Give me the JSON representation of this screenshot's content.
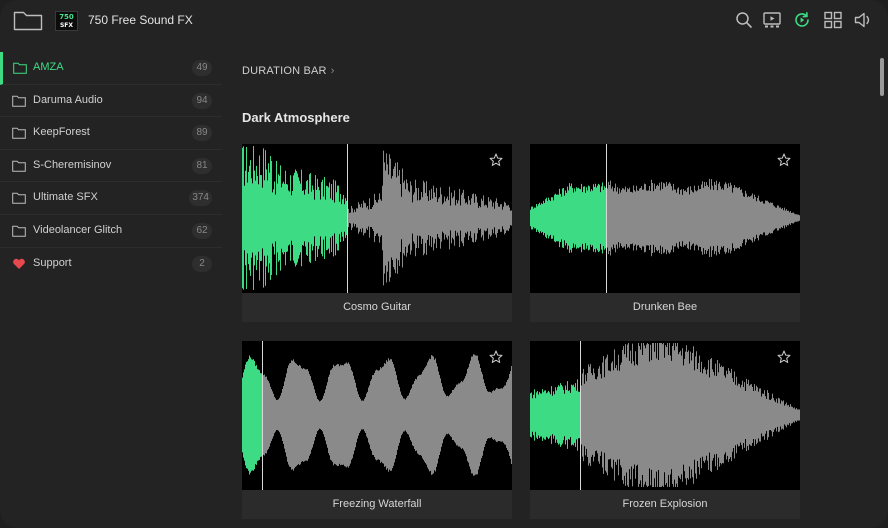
{
  "header": {
    "title": "750 Free Sound FX",
    "logo_number": "750",
    "logo_text": "SFX",
    "icons": [
      "search-icon",
      "video-player-icon",
      "play-refresh-icon",
      "grid-view-icon",
      "volume-icon"
    ]
  },
  "sidebar": {
    "items": [
      {
        "label": "AMZA",
        "count": "49",
        "icon": "folder-icon",
        "active": true
      },
      {
        "label": "Daruma Audio",
        "count": "94",
        "icon": "folder-icon"
      },
      {
        "label": "KeepForest",
        "count": "89",
        "icon": "folder-icon"
      },
      {
        "label": "S-Cheremisinov",
        "count": "81",
        "icon": "folder-icon"
      },
      {
        "label": "Ultimate SFX",
        "count": "374",
        "icon": "folder-icon"
      },
      {
        "label": "Videolancer Glitch",
        "count": "62",
        "icon": "folder-icon"
      },
      {
        "label": "Support",
        "count": "2",
        "icon": "heart-icon"
      }
    ]
  },
  "main": {
    "breadcrumb": "DURATION BAR",
    "section_title": "Dark Atmosphere",
    "cards": [
      {
        "name": "Cosmo Guitar"
      },
      {
        "name": "Drunken Bee"
      },
      {
        "name": "Freezing Waterfall"
      },
      {
        "name": "Frozen Explosion"
      }
    ]
  },
  "colors": {
    "accent": "#3ddc84",
    "background": "#232323",
    "card": "#2b2b2b",
    "waveform_played": "#3ddc84",
    "waveform_unplayed": "#8a8a8a",
    "support_heart": "#e5484d"
  }
}
